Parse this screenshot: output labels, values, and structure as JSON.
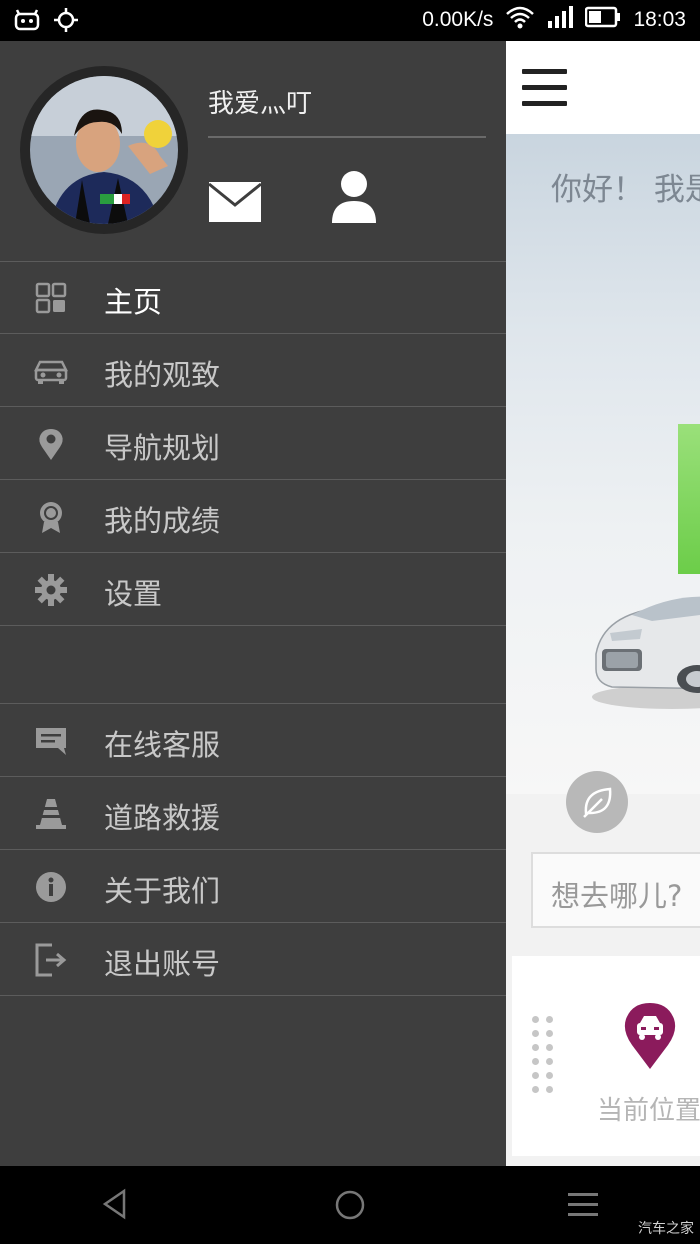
{
  "status_bar": {
    "speed": "0.00K/s",
    "time": "18:03"
  },
  "drawer": {
    "username": "我爱灬叮",
    "menu": [
      {
        "label": "主页",
        "icon": "grid-icon",
        "active": true
      },
      {
        "label": "我的观致",
        "icon": "car-icon"
      },
      {
        "label": "导航规划",
        "icon": "location-pin-icon"
      },
      {
        "label": "我的成绩",
        "icon": "badge-icon"
      },
      {
        "label": "设置",
        "icon": "gear-icon"
      }
    ],
    "secondary_menu": [
      {
        "label": "在线客服",
        "icon": "chat-icon"
      },
      {
        "label": "道路救援",
        "icon": "traffic-cone-icon"
      },
      {
        "label": "关于我们",
        "icon": "info-icon"
      },
      {
        "label": "退出账号",
        "icon": "logout-icon"
      }
    ]
  },
  "main": {
    "greeting": "你好！ 我是",
    "search_placeholder": "想去哪儿?",
    "location_label": "当前位置"
  },
  "watermark": "汽车之家",
  "colors": {
    "drawer_bg": "#3e3e3e",
    "pin": "#8b1b5c",
    "green": "#6ccd49"
  }
}
